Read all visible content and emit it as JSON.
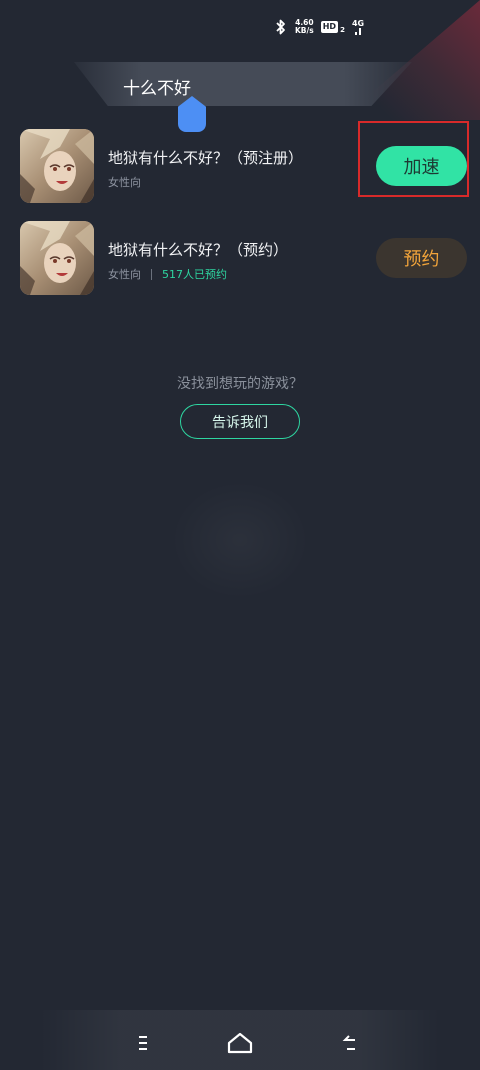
{
  "status_bar": {
    "bluetooth_icon": "bluetooth-icon",
    "net_speed_value": "4.60",
    "net_speed_unit": "KB/s",
    "hd_label": "HD",
    "sim_number": "2",
    "network_type": "4G"
  },
  "search": {
    "query": "十么不好"
  },
  "games": [
    {
      "title": "地狱有什么不好？（预注册）",
      "tag": "女性向",
      "count": "",
      "action_label": "加速"
    },
    {
      "title": "地狱有什么不好？（预约）",
      "tag": "女性向",
      "count": "517人已预约",
      "action_label": "预约"
    }
  ],
  "not_found": {
    "prompt": "没找到想玩的游戏？",
    "button_label": "告诉我们"
  },
  "nav": {
    "menu_icon": "menu-icon",
    "home_icon": "home-icon",
    "back_icon": "back-icon"
  },
  "colors": {
    "background": "#232833",
    "accent_green": "#31e3a5",
    "reserve_orange": "#f2a43a",
    "highlight_red": "#d82a2a",
    "cursor_blue": "#4d8ff4"
  }
}
